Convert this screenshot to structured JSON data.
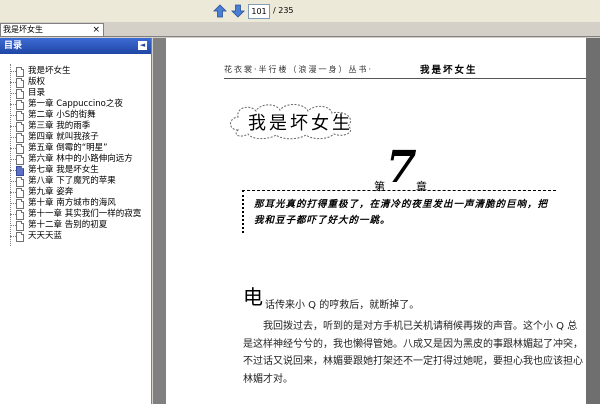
{
  "toolbar": {
    "page_current": "101",
    "page_total": "/ 235",
    "prev_icon": "arrow-up-icon",
    "next_icon": "arrow-down-icon"
  },
  "tab": {
    "title": "我是坏女生",
    "close": "×"
  },
  "sidebar": {
    "title": "目录",
    "collapse": "◄",
    "items": [
      {
        "label": "我是坏女生"
      },
      {
        "label": "版权"
      },
      {
        "label": "目录"
      },
      {
        "label": "第一章 Cappuccino之夜"
      },
      {
        "label": "第二章 小S的街舞"
      },
      {
        "label": "第三章 我的雨季"
      },
      {
        "label": "第四章 就叫我孩子"
      },
      {
        "label": "第五章 倒霉的“明星”"
      },
      {
        "label": "第六章 林中的小路伸向远方"
      },
      {
        "label": "第七章 我是坏女生",
        "current": true
      },
      {
        "label": "第八章 下了魔咒的苹果"
      },
      {
        "label": "第九章 姿奔"
      },
      {
        "label": "第十章 南方城市的海风"
      },
      {
        "label": "第十一章 其实我们一样的寂寞"
      },
      {
        "label": "第十二章 告别的初夏"
      },
      {
        "label": "天天天蓝"
      }
    ]
  },
  "page": {
    "header_series": "花衣裳·半行楼（浪漫一身）丛书·",
    "header_title": "我是坏女生",
    "chapter_title": "我是坏女生",
    "chapter_prefix": "第",
    "chapter_number": "7",
    "chapter_suffix": "章",
    "epigraph": "那耳光真的打得重极了，在清冷的夜里发出一声清脆的巨响，把我和豆子都吓了好大的一跳。",
    "dropcap": "电",
    "first_line": "话传来小 Q 的哼救后，就断掉了。",
    "paragraph": "我回拨过去，听到的是对方手机已关机请稍候再拨的声音。这个小 Q 总是这样神经兮兮的，我也懒得管她。八成又是因为黑皮的事跟林媚起了冲突，不过话又说回来，林媚要跟她打架还不一定打得过她呢，要担心我也应该担心林媚才对。"
  }
}
